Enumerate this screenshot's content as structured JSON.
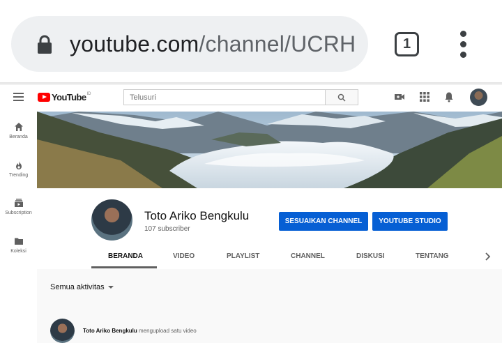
{
  "browser": {
    "url_domain": "youtube.com",
    "url_path": "/channel/UCRH",
    "tab_count": "1"
  },
  "header": {
    "logo_text": "YouTube",
    "logo_country": "ID",
    "search_placeholder": "Telusuri"
  },
  "sidebar": {
    "items": [
      {
        "label": "Beranda",
        "icon": "home-icon"
      },
      {
        "label": "Trending",
        "icon": "flame-icon"
      },
      {
        "label": "Subscription",
        "icon": "subscriptions-icon"
      },
      {
        "label": "Koleksi",
        "icon": "folder-icon"
      }
    ]
  },
  "channel": {
    "name": "Toto Ariko Bengkulu",
    "subscribers": "107 subscriber",
    "customize_label": "SESUAIKAN CHANNEL",
    "studio_label": "YOUTUBE STUDIO"
  },
  "tabs": [
    "BERANDA",
    "VIDEO",
    "PLAYLIST",
    "CHANNEL",
    "DISKUSI",
    "TENTANG"
  ],
  "feed": {
    "filter_label": "Semua aktivitas",
    "activity_user": "Toto Ariko Bengkulu",
    "activity_text": "mengupload satu video"
  },
  "colors": {
    "accent_blue": "#065fd4",
    "brand_red": "#ff0000"
  }
}
